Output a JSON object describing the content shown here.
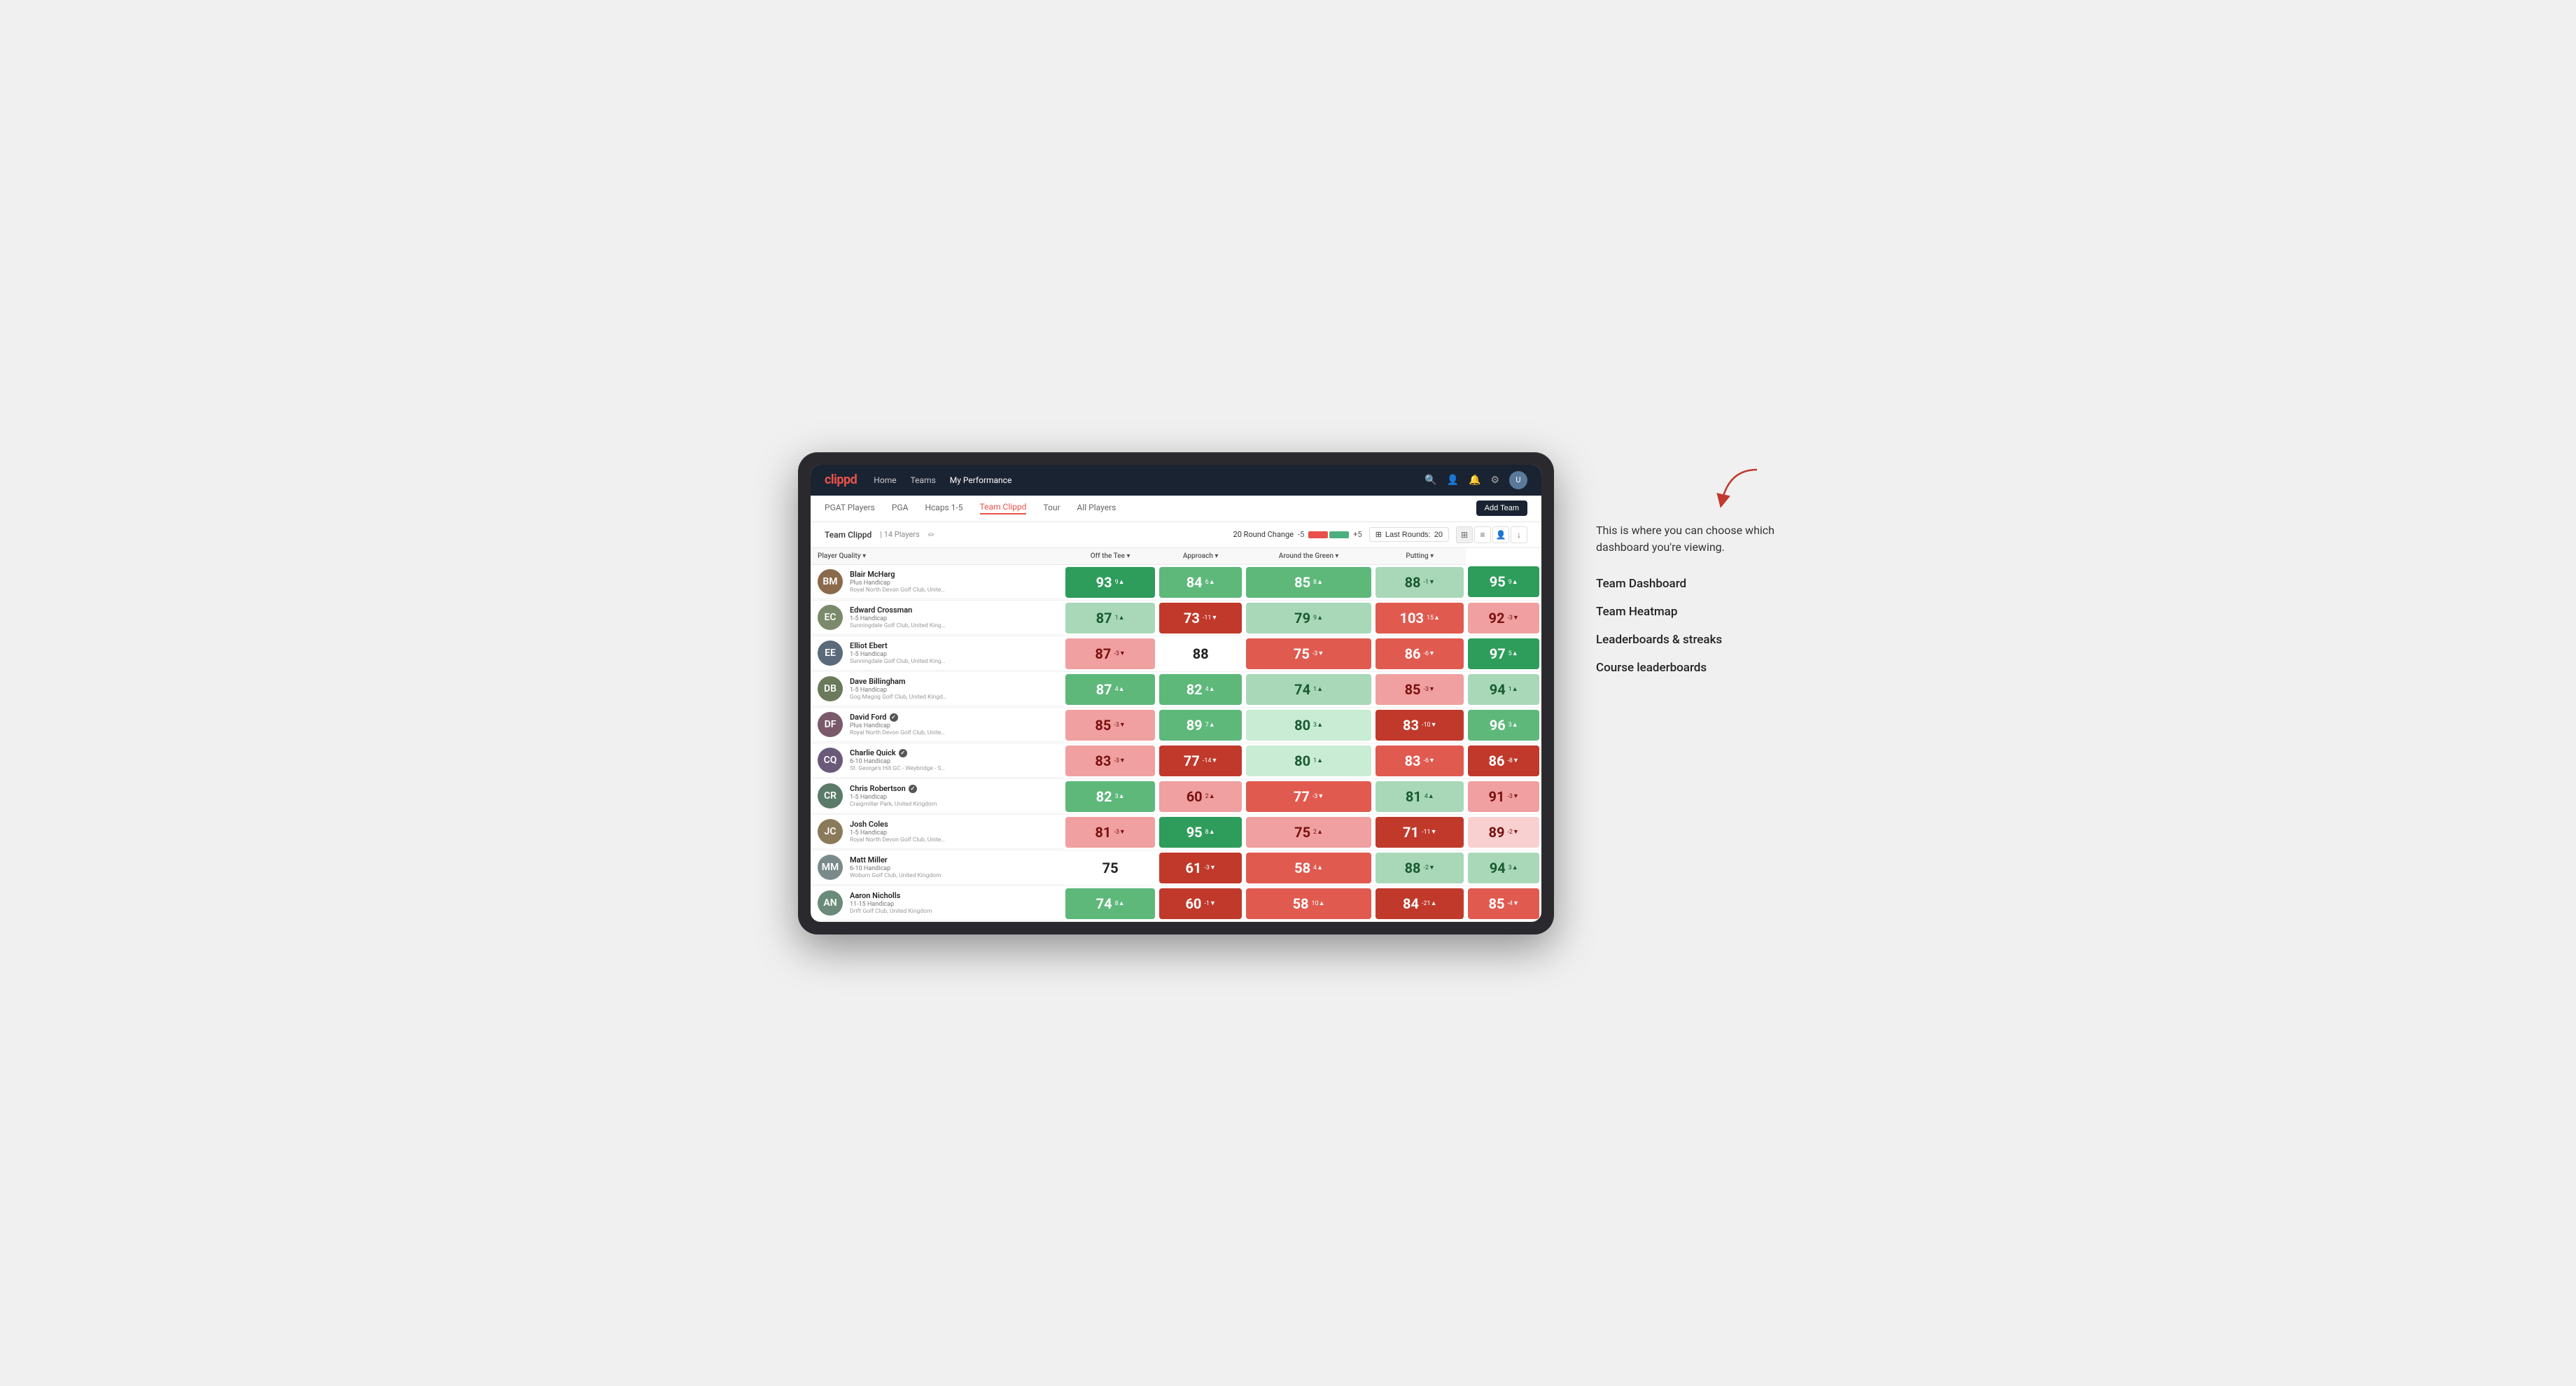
{
  "annotation": {
    "description": "This is where you can choose which dashboard you're viewing.",
    "items": [
      "Team Dashboard",
      "Team Heatmap",
      "Leaderboards & streaks",
      "Course leaderboards"
    ]
  },
  "nav": {
    "logo": "clippd",
    "links": [
      "Home",
      "Teams",
      "My Performance"
    ],
    "active_link": "My Performance"
  },
  "sub_nav": {
    "links": [
      "PGAT Players",
      "PGA",
      "Hcaps 1-5",
      "Team Clippd",
      "Tour",
      "All Players"
    ],
    "active_link": "Team Clippd",
    "add_team_label": "Add Team"
  },
  "toolbar": {
    "team_name": "Team Clippd",
    "player_count": "14 Players",
    "round_change_label": "20 Round Change",
    "change_low": "-5",
    "change_high": "+5",
    "last_rounds_label": "Last Rounds:",
    "last_rounds_value": "20"
  },
  "table": {
    "columns": [
      "Player Quality ▾",
      "Off the Tee ▾",
      "Approach ▾",
      "Around the Green ▾",
      "Putting ▾"
    ],
    "players": [
      {
        "name": "Blair McHarg",
        "handicap": "Plus Handicap",
        "club": "Royal North Devon Golf Club, United Kingdom",
        "avatar_color": "#8a6a4a",
        "initials": "BM",
        "scores": [
          {
            "value": "93",
            "change": "9▲",
            "bg": "bg-green-dark"
          },
          {
            "value": "84",
            "change": "6▲",
            "bg": "bg-green-mid"
          },
          {
            "value": "85",
            "change": "8▲",
            "bg": "bg-green-mid"
          },
          {
            "value": "88",
            "change": "-1▼",
            "bg": "bg-green-light"
          },
          {
            "value": "95",
            "change": "9▲",
            "bg": "bg-green-dark"
          }
        ]
      },
      {
        "name": "Edward Crossman",
        "handicap": "1-5 Handicap",
        "club": "Sunningdale Golf Club, United Kingdom",
        "avatar_color": "#7a8a6a",
        "initials": "EC",
        "scores": [
          {
            "value": "87",
            "change": "1▲",
            "bg": "bg-green-light"
          },
          {
            "value": "73",
            "change": "-11▼",
            "bg": "bg-red-dark"
          },
          {
            "value": "79",
            "change": "9▲",
            "bg": "bg-green-light"
          },
          {
            "value": "103",
            "change": "15▲",
            "bg": "bg-red-mid"
          },
          {
            "value": "92",
            "change": "-3▼",
            "bg": "bg-red-light"
          }
        ]
      },
      {
        "name": "Elliot Ebert",
        "handicap": "1-5 Handicap",
        "club": "Sunningdale Golf Club, United Kingdom",
        "avatar_color": "#5a6a7a",
        "initials": "EE",
        "scores": [
          {
            "value": "87",
            "change": "-3▼",
            "bg": "bg-red-light"
          },
          {
            "value": "88",
            "change": "",
            "bg": "bg-white"
          },
          {
            "value": "75",
            "change": "-3▼",
            "bg": "bg-red-mid"
          },
          {
            "value": "86",
            "change": "-6▼",
            "bg": "bg-red-mid"
          },
          {
            "value": "97",
            "change": "5▲",
            "bg": "bg-green-dark"
          }
        ]
      },
      {
        "name": "Dave Billingham",
        "handicap": "1-5 Handicap",
        "club": "Gog Magog Golf Club, United Kingdom",
        "avatar_color": "#6a7a5a",
        "initials": "DB",
        "scores": [
          {
            "value": "87",
            "change": "4▲",
            "bg": "bg-green-mid"
          },
          {
            "value": "82",
            "change": "4▲",
            "bg": "bg-green-mid"
          },
          {
            "value": "74",
            "change": "1▲",
            "bg": "bg-green-light"
          },
          {
            "value": "85",
            "change": "-3▼",
            "bg": "bg-red-light"
          },
          {
            "value": "94",
            "change": "1▲",
            "bg": "bg-green-light"
          }
        ]
      },
      {
        "name": "David Ford",
        "handicap": "Plus Handicap",
        "club": "Royal North Devon Golf Club, United Kingdom",
        "avatar_color": "#7a5a6a",
        "initials": "DF",
        "has_icon": true,
        "scores": [
          {
            "value": "85",
            "change": "-3▼",
            "bg": "bg-red-light"
          },
          {
            "value": "89",
            "change": "7▲",
            "bg": "bg-green-mid"
          },
          {
            "value": "80",
            "change": "3▲",
            "bg": "bg-green-pale"
          },
          {
            "value": "83",
            "change": "-10▼",
            "bg": "bg-red-dark"
          },
          {
            "value": "96",
            "change": "3▲",
            "bg": "bg-green-mid"
          }
        ]
      },
      {
        "name": "Charlie Quick",
        "handicap": "6-10 Handicap",
        "club": "St. George's Hill GC - Weybridge - Surrey, Uni...",
        "avatar_color": "#6a5a7a",
        "initials": "CQ",
        "has_icon": true,
        "scores": [
          {
            "value": "83",
            "change": "-3▼",
            "bg": "bg-red-light"
          },
          {
            "value": "77",
            "change": "-14▼",
            "bg": "bg-red-dark"
          },
          {
            "value": "80",
            "change": "1▲",
            "bg": "bg-green-pale"
          },
          {
            "value": "83",
            "change": "-6▼",
            "bg": "bg-red-mid"
          },
          {
            "value": "86",
            "change": "-8▼",
            "bg": "bg-red-dark"
          }
        ]
      },
      {
        "name": "Chris Robertson",
        "handicap": "1-5 Handicap",
        "club": "Craigmillar Park, United Kingdom",
        "avatar_color": "#5a7a6a",
        "initials": "CR",
        "has_icon": true,
        "scores": [
          {
            "value": "82",
            "change": "3▲",
            "bg": "bg-green-mid"
          },
          {
            "value": "60",
            "change": "2▲",
            "bg": "bg-red-light"
          },
          {
            "value": "77",
            "change": "-3▼",
            "bg": "bg-red-mid"
          },
          {
            "value": "81",
            "change": "4▲",
            "bg": "bg-green-light"
          },
          {
            "value": "91",
            "change": "-3▼",
            "bg": "bg-red-light"
          }
        ]
      },
      {
        "name": "Josh Coles",
        "handicap": "1-5 Handicap",
        "club": "Royal North Devon Golf Club, United Kingdom",
        "avatar_color": "#8a7a5a",
        "initials": "JC",
        "scores": [
          {
            "value": "81",
            "change": "-3▼",
            "bg": "bg-red-light"
          },
          {
            "value": "95",
            "change": "8▲",
            "bg": "bg-green-dark"
          },
          {
            "value": "75",
            "change": "2▲",
            "bg": "bg-red-light"
          },
          {
            "value": "71",
            "change": "-11▼",
            "bg": "bg-red-dark"
          },
          {
            "value": "89",
            "change": "-2▼",
            "bg": "bg-red-pale"
          }
        ]
      },
      {
        "name": "Matt Miller",
        "handicap": "6-10 Handicap",
        "club": "Woburn Golf Club, United Kingdom",
        "avatar_color": "#7a8a8a",
        "initials": "MM",
        "scores": [
          {
            "value": "75",
            "change": "",
            "bg": "bg-white"
          },
          {
            "value": "61",
            "change": "-3▼",
            "bg": "bg-red-dark"
          },
          {
            "value": "58",
            "change": "4▲",
            "bg": "bg-red-mid"
          },
          {
            "value": "88",
            "change": "-2▼",
            "bg": "bg-green-light"
          },
          {
            "value": "94",
            "change": "3▲",
            "bg": "bg-green-light"
          }
        ]
      },
      {
        "name": "Aaron Nicholls",
        "handicap": "11-15 Handicap",
        "club": "Drift Golf Club, United Kingdom",
        "avatar_color": "#6a8a7a",
        "initials": "AN",
        "scores": [
          {
            "value": "74",
            "change": "8▲",
            "bg": "bg-green-mid"
          },
          {
            "value": "60",
            "change": "-1▼",
            "bg": "bg-red-dark"
          },
          {
            "value": "58",
            "change": "10▲",
            "bg": "bg-red-mid"
          },
          {
            "value": "84",
            "change": "-21▲",
            "bg": "bg-red-dark"
          },
          {
            "value": "85",
            "change": "-4▼",
            "bg": "bg-red-mid"
          }
        ]
      }
    ]
  }
}
